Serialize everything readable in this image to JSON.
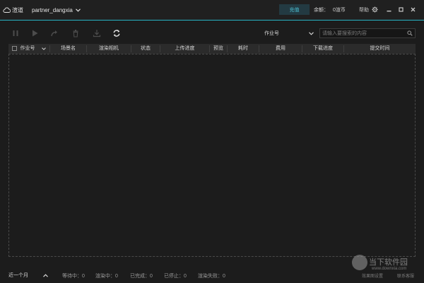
{
  "titlebar": {
    "app_name": "渲道",
    "username": "partner_dangxia",
    "recharge_label": "充值",
    "balance_label": "余额：",
    "balance_value": "0渲币",
    "help_label": "帮助"
  },
  "toolbar": {
    "filter_field": "作业号",
    "search_placeholder": "请输入要搜索的内容"
  },
  "table": {
    "columns": [
      "作业号",
      "场景名",
      "渲染相机",
      "状态",
      "上传进度",
      "预览",
      "耗时",
      "费用",
      "下载进度",
      "提交时间"
    ],
    "rows": []
  },
  "footer": {
    "range_label": "近一个月",
    "stats": [
      "等待中：0",
      "渲染中：0",
      "已完成：0",
      "已停止：0",
      "渲染失败：0"
    ],
    "links": [
      "效果图设置",
      "联系客服"
    ]
  },
  "watermark": {
    "text": "当下软件园",
    "url": "www.downxia.com"
  },
  "colors": {
    "accent": "#27b3c4",
    "background": "#1c1c1c",
    "header": "#2b2b2b"
  }
}
